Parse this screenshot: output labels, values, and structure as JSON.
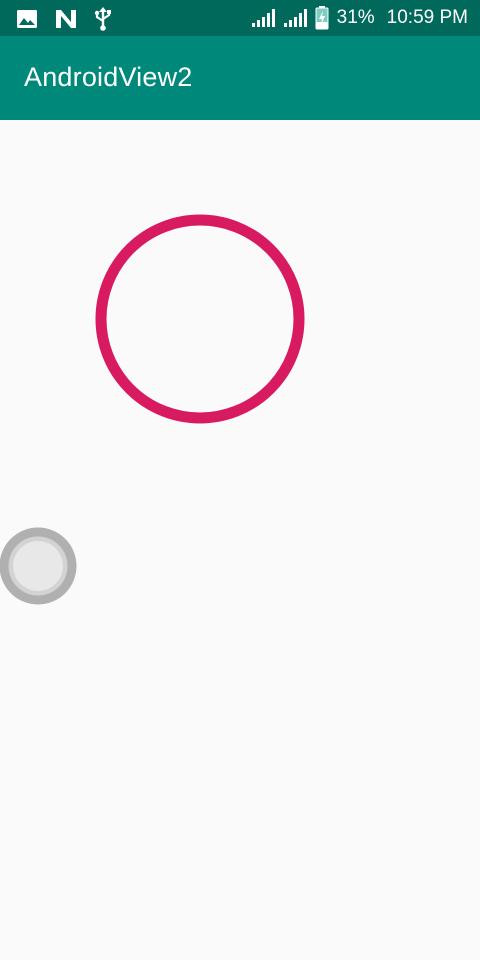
{
  "status_bar": {
    "icons_left": [
      "image-icon",
      "n-notification-icon",
      "usb-icon"
    ],
    "icons_right": [
      "signal-sim1-icon",
      "signal-sim2-icon",
      "battery-charging-icon"
    ],
    "battery": "31%",
    "time": "10:59 PM",
    "bg_color": "#00695C"
  },
  "app_bar": {
    "title": "AndroidView2",
    "bg_color": "#00897B"
  },
  "canvas": {
    "ring_color": "#D81B60",
    "handle_color": "#B0B0B0",
    "handle_fill": "#E8E8E8"
  }
}
